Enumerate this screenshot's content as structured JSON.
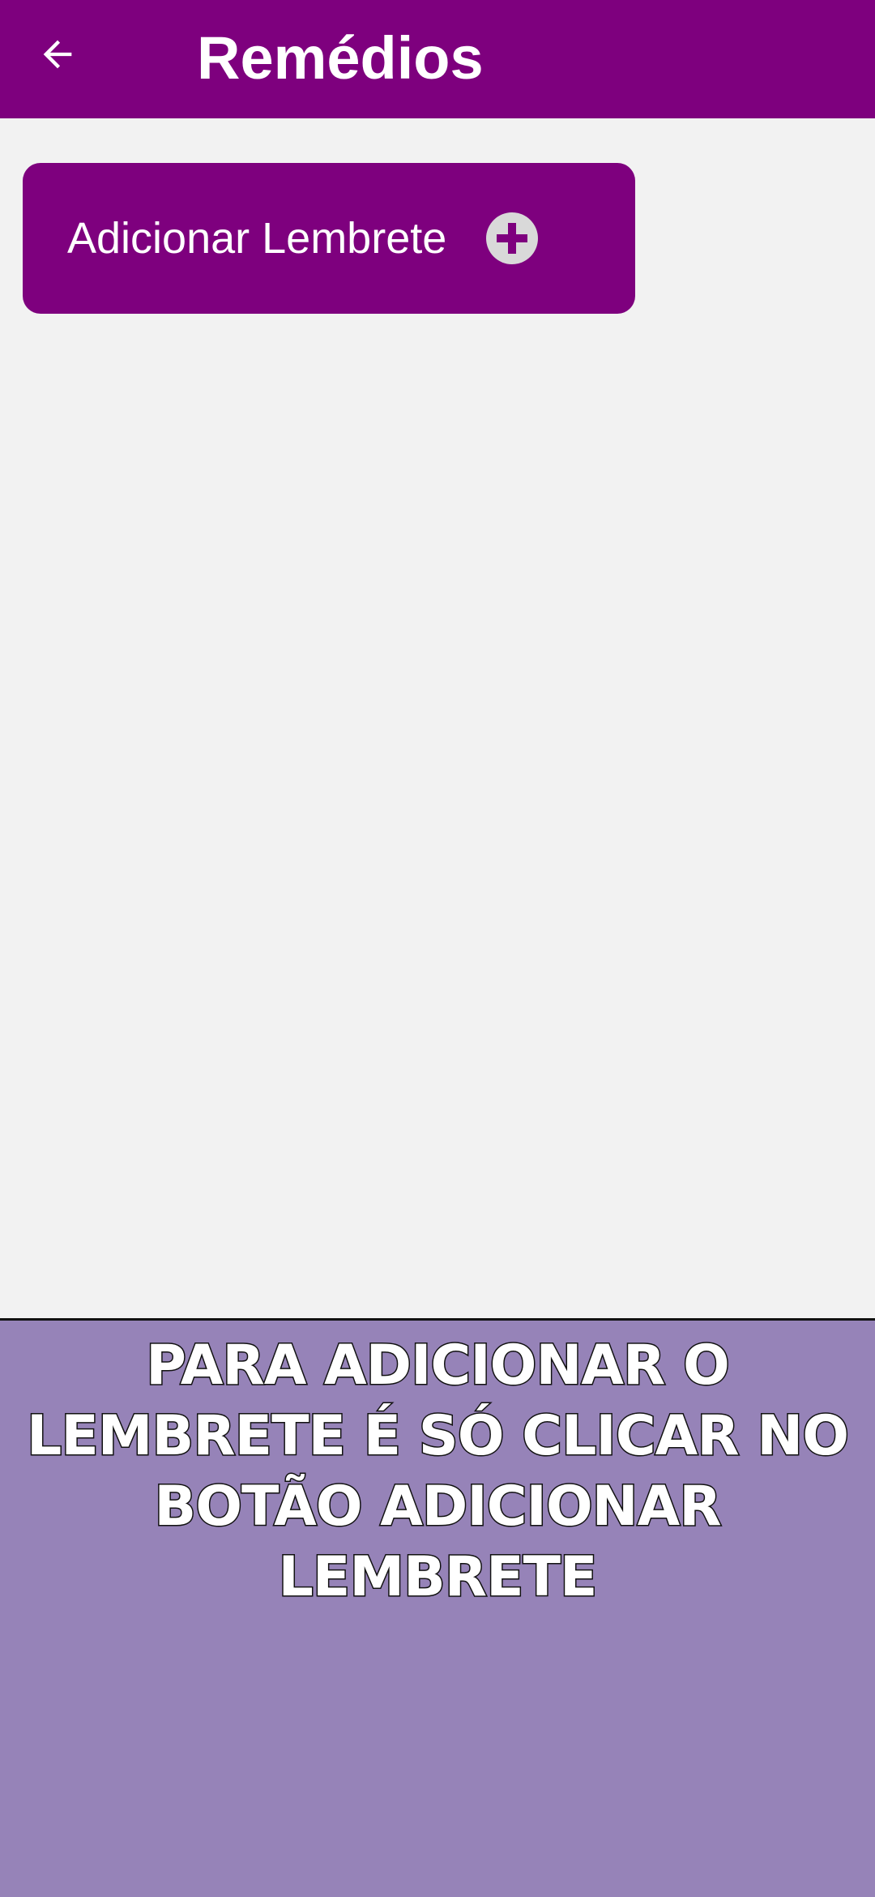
{
  "header": {
    "title": "Remédios",
    "back_icon": "arrow-left-icon"
  },
  "main": {
    "add_button_label": "Adicionar Lembrete",
    "add_button_icon": "plus-circle-icon"
  },
  "helper": {
    "message": "PARA ADICIONAR O LEMBRETE É SÓ CLICAR NO BOTÃO ADICIONAR LEMBRETE"
  },
  "colors": {
    "primary": "#7e007e",
    "background": "#f2f2f2",
    "helper_background": "#9683b8",
    "icon_circle": "#d9d9d9"
  }
}
